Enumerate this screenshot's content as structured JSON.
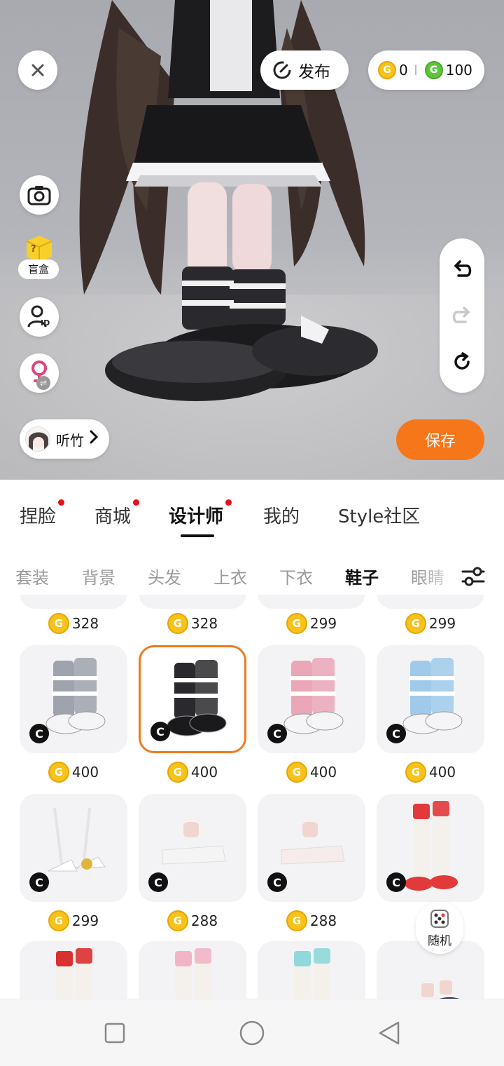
{
  "preview": {
    "publish_label": "发布",
    "coins": {
      "gold": "0",
      "green": "100"
    },
    "coin_symbol": "G",
    "blind_box_label": "盲盒",
    "blind_box_mark": "?",
    "id_label": "ID",
    "user_name": "听竹",
    "save_label": "保存",
    "swap_glyph": "⇌"
  },
  "tabs": [
    {
      "label": "捏脸",
      "dot": true
    },
    {
      "label": "商城",
      "dot": true
    },
    {
      "label": "设计师",
      "dot": true,
      "active": true
    },
    {
      "label": "我的",
      "dot": false
    },
    {
      "label": "Style社区",
      "dot": false
    }
  ],
  "categories": [
    "套装",
    "背景",
    "头发",
    "上衣",
    "下衣",
    "鞋子",
    "眼睛"
  ],
  "active_category": "鞋子",
  "grid": {
    "top_row_prices": [
      "328",
      "328",
      "299",
      "299"
    ],
    "items": [
      {
        "price": "400",
        "color": "#9ea3ad",
        "kind": "boot",
        "selected": false
      },
      {
        "price": "400",
        "color": "#2a2a2e",
        "kind": "boot",
        "selected": true
      },
      {
        "price": "400",
        "color": "#eba6b8",
        "kind": "boot",
        "selected": false
      },
      {
        "price": "400",
        "color": "#9fcaea",
        "kind": "boot",
        "selected": false
      },
      {
        "price": "299",
        "color": "#ffffff",
        "kind": "heel",
        "selected": false
      },
      {
        "price": "288",
        "color": "#f4f4f4",
        "kind": "loafer",
        "selected": false
      },
      {
        "price": "288",
        "color": "#f6ecec",
        "kind": "loafer",
        "selected": false
      },
      {
        "price": "",
        "color": "#e23a3a",
        "kind": "sock",
        "selected": false
      },
      {
        "price": "",
        "color": "#d93030",
        "kind": "tallsock",
        "selected": false
      },
      {
        "price": "",
        "color": "#f2b5c8",
        "kind": "tallsock",
        "selected": false
      },
      {
        "price": "",
        "color": "#8fd8dc",
        "kind": "tallsock",
        "selected": false
      },
      {
        "price": "",
        "color": "#1f2230",
        "kind": "dark",
        "selected": false
      }
    ],
    "badge_letter": "C"
  },
  "random_label": "随机",
  "colors": {
    "accent": "#f6761a",
    "gold": "#f7c21a",
    "green": "#5fc63b",
    "dot": "#e8101a"
  }
}
